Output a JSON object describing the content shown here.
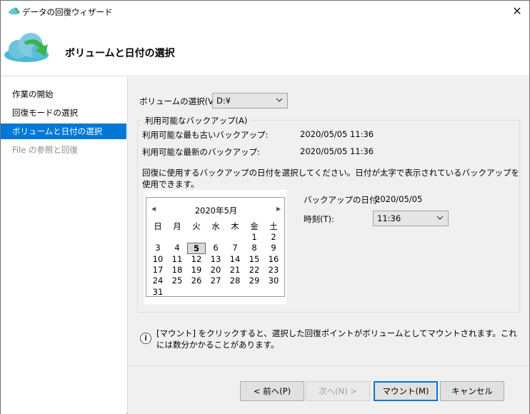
{
  "window": {
    "title": "データの回復ウィザード",
    "close_glyph": "✕"
  },
  "header": {
    "title": "ボリュームと日付の選択"
  },
  "sidebar": {
    "items": [
      {
        "label": "作業の開始"
      },
      {
        "label": "回復モードの選択"
      },
      {
        "label": "ボリュームと日付の選択"
      },
      {
        "label": "File の参照と回復"
      }
    ]
  },
  "volume": {
    "label": "ボリュームの選択(V):",
    "value": "D:¥"
  },
  "backups": {
    "group_label": "利用可能なバックアップ(A)",
    "oldest_label": "利用可能な最も古いバックアップ:",
    "oldest_value": "2020/05/05 11:36",
    "newest_label": "利用可能な最新のバックアップ:",
    "newest_value": "2020/05/05 11:36",
    "description": "回復に使用するバックアップの日付を選択してください。日付が太字で表示されているバックアップを使用できます。",
    "backup_date_label": "バックアップの日付:",
    "backup_date_value": "2020/05/05",
    "time_label": "時刻(T):",
    "time_value": "11:36"
  },
  "calendar": {
    "month_title": "2020年5月",
    "prev_glyph": "◀",
    "next_glyph": "▶",
    "weekdays": [
      "日",
      "月",
      "火",
      "水",
      "木",
      "金",
      "土"
    ],
    "days": [
      "1",
      "2",
      "3",
      "4",
      "5",
      "6",
      "7",
      "8",
      "9",
      "10",
      "11",
      "12",
      "13",
      "14",
      "15",
      "16",
      "17",
      "18",
      "19",
      "20",
      "21",
      "22",
      "23",
      "24",
      "25",
      "26",
      "27",
      "28",
      "29",
      "30",
      "31"
    ],
    "selected_day": "5"
  },
  "info": {
    "text": "[マウント] をクリックすると、選択した回復ポイントがボリュームとしてマウントされます。これには数分かかることがあります。"
  },
  "buttons": {
    "back": "< 前へ(P)",
    "next": "次へ(N) >",
    "mount": "マウント(M)",
    "cancel": "キャンセル"
  },
  "colors": {
    "accent": "#0078d7",
    "panel": "#f0f0f0",
    "cloud_blue": "#4fb7d6",
    "arrow_green": "#3bb54a"
  }
}
